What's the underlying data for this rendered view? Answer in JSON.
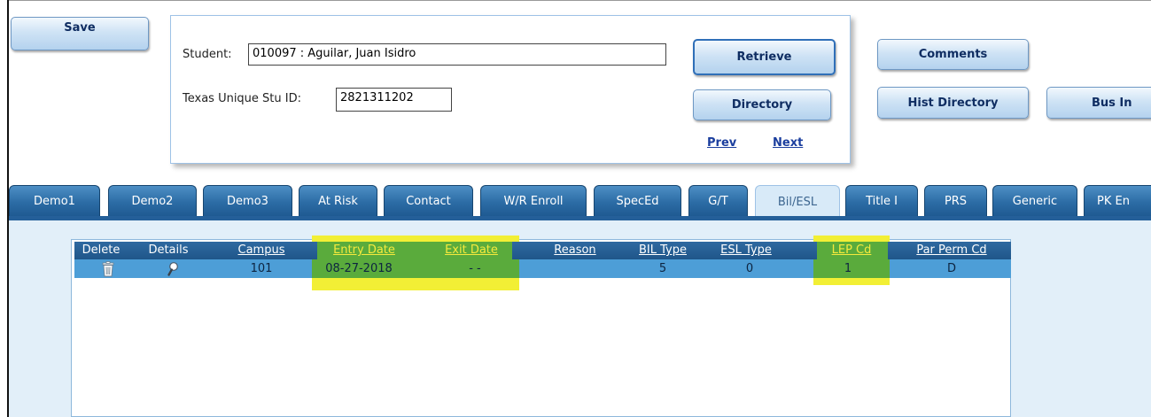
{
  "toolbar": {
    "save_label": "Save"
  },
  "student_panel": {
    "student_label": "Student:",
    "student_value": "010097 : Aguilar, Juan Isidro",
    "texas_id_label": "Texas Unique Stu ID:",
    "texas_id_value": "2821311202",
    "retrieve_label": "Retrieve",
    "directory_label": "Directory",
    "prev_label": "Prev",
    "next_label": "Next"
  },
  "right_buttons": {
    "comments_label": "Comments",
    "hist_directory_label": "Hist Directory",
    "bus_info_label": "Bus In"
  },
  "tabs": [
    {
      "label": "Demo1"
    },
    {
      "label": "Demo2"
    },
    {
      "label": "Demo3"
    },
    {
      "label": "At Risk"
    },
    {
      "label": "Contact"
    },
    {
      "label": "W/R Enroll"
    },
    {
      "label": "SpecEd"
    },
    {
      "label": "G/T"
    },
    {
      "label": "Bil/ESL"
    },
    {
      "label": "Title I"
    },
    {
      "label": "PRS"
    },
    {
      "label": "Generic"
    },
    {
      "label": "PK En"
    }
  ],
  "active_tab": "Bil/ESL",
  "grid": {
    "columns": [
      {
        "label": "Delete"
      },
      {
        "label": "Details"
      },
      {
        "label": "Campus"
      },
      {
        "label": "Entry Date"
      },
      {
        "label": "Exit Date"
      },
      {
        "label": "Reason"
      },
      {
        "label": "BIL Type"
      },
      {
        "label": "ESL Type"
      },
      {
        "label": "LEP Cd"
      },
      {
        "label": "Par Perm Cd"
      }
    ],
    "rows": [
      {
        "delete_icon": "trash-icon",
        "details_icon": "magnifier-icon",
        "campus": "101",
        "entry_date": "08-27-2018",
        "exit_date": "- -",
        "reason": "",
        "bil_type": "5",
        "esl_type": "0",
        "lep_cd": "1",
        "par_perm_cd": "D"
      }
    ]
  },
  "colors": {
    "tab_blue": "#2c6ca5",
    "header_blue": "#1f5689",
    "row_blue": "#4d9ed7",
    "highlight_yellow": "#f2ef35",
    "highlight_green": "#5aab3c",
    "link_blue": "#1b3e9e"
  }
}
